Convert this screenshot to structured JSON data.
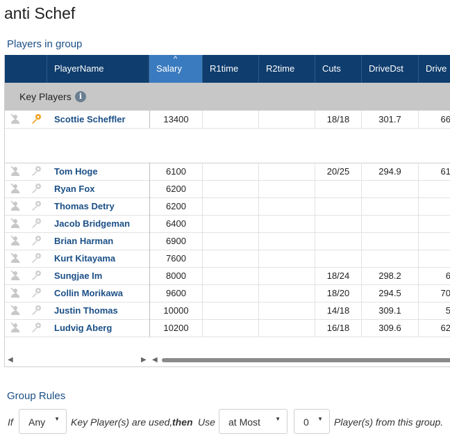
{
  "page_title": "anti Schef",
  "players_section_label": "Players in group",
  "columns": [
    "PlayerName",
    "Salary",
    "R1time",
    "R2time",
    "Cuts",
    "DriveDst",
    "Drive"
  ],
  "sort_indicator": "^",
  "group_label": "Key Players",
  "key_player": {
    "name": "Scottie Scheffler",
    "salary": "13400",
    "r1": "",
    "r2": "",
    "cuts": "18/18",
    "drivedst": "301.7",
    "drive": "66"
  },
  "players": [
    {
      "name": "Tom Hoge",
      "salary": "6100",
      "r1": "",
      "r2": "",
      "cuts": "20/25",
      "drivedst": "294.9",
      "drive": "61"
    },
    {
      "name": "Ryan Fox",
      "salary": "6200",
      "r1": "",
      "r2": "",
      "cuts": "",
      "drivedst": "",
      "drive": ""
    },
    {
      "name": "Thomas Detry",
      "salary": "6200",
      "r1": "",
      "r2": "",
      "cuts": "",
      "drivedst": "",
      "drive": ""
    },
    {
      "name": "Jacob Bridgeman",
      "salary": "6400",
      "r1": "",
      "r2": "",
      "cuts": "",
      "drivedst": "",
      "drive": ""
    },
    {
      "name": "Brian Harman",
      "salary": "6900",
      "r1": "",
      "r2": "",
      "cuts": "",
      "drivedst": "",
      "drive": ""
    },
    {
      "name": "Kurt Kitayama",
      "salary": "7600",
      "r1": "",
      "r2": "",
      "cuts": "",
      "drivedst": "",
      "drive": ""
    },
    {
      "name": "Sungjae Im",
      "salary": "8000",
      "r1": "",
      "r2": "",
      "cuts": "18/24",
      "drivedst": "298.2",
      "drive": "6"
    },
    {
      "name": "Collin Morikawa",
      "salary": "9600",
      "r1": "",
      "r2": "",
      "cuts": "18/20",
      "drivedst": "294.5",
      "drive": "70"
    },
    {
      "name": "Justin Thomas",
      "salary": "10000",
      "r1": "",
      "r2": "",
      "cuts": "14/18",
      "drivedst": "309.1",
      "drive": "5"
    },
    {
      "name": "Ludvig Aberg",
      "salary": "10200",
      "r1": "",
      "r2": "",
      "cuts": "16/18",
      "drivedst": "309.6",
      "drive": "62"
    }
  ],
  "group_rules": {
    "label": "Group Rules",
    "if_text": "If",
    "mid_text_1": "Key Player(s) are used,",
    "then_text": "then",
    "use_text": "Use",
    "end_text": "Player(s) from this group.",
    "condition_value": "Any",
    "limit_value": "at Most",
    "count_value": "0"
  },
  "icons": {
    "user": "user-slash-icon",
    "key": "key-icon",
    "info": "info-icon"
  },
  "colors": {
    "header_bg": "#0f3d6e",
    "sorted_header_bg": "#3a7bbf",
    "link_text": "#1b4f86",
    "group_bg": "#c7c7c7",
    "key_active": "#f0a020"
  }
}
